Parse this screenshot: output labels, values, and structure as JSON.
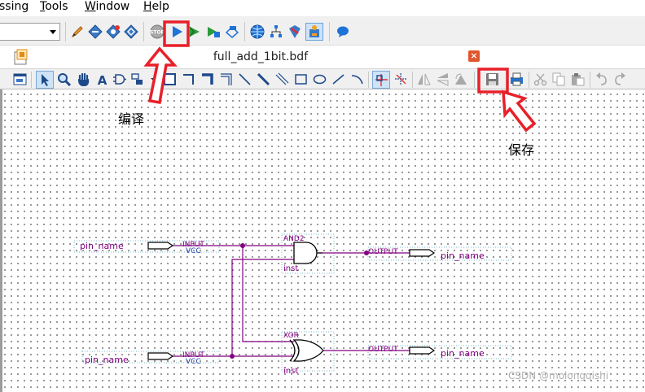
{
  "menu": {
    "items": [
      {
        "label": "ssing"
      },
      {
        "label": "Tools"
      },
      {
        "label": "Window"
      },
      {
        "label": "Help"
      }
    ]
  },
  "document": {
    "title": "full_add_1bit.bdf",
    "close_label": "×"
  },
  "annotations": {
    "compile": "编译",
    "save": "保存"
  },
  "schematic": {
    "input_pins": [
      {
        "name": "pin_name",
        "type": "INPUT",
        "default": "VCC"
      },
      {
        "name": "pin_name",
        "type": "INPUT",
        "default": "VCC"
      }
    ],
    "output_pins": [
      {
        "name": "pin_name",
        "type": "OUTPUT"
      },
      {
        "name": "pin_name",
        "type": "OUTPUT"
      }
    ],
    "gates": [
      {
        "type": "AND2",
        "instance": "inst"
      },
      {
        "type": "XOR",
        "instance": "inst"
      }
    ],
    "wire_color": "#800080"
  },
  "watermark": "CSDN @molongqishi",
  "colors": {
    "highlight": "#e8202a",
    "close": "#e0562e"
  },
  "icons": [
    "pencil-icon",
    "diamond-icon",
    "analysis-icon",
    "chip-icon",
    "stop-icon",
    "start-compile-icon",
    "flag-icon",
    "fitter-icon",
    "timing-icon",
    "globe-icon",
    "netlist-icon",
    "programmer-icon",
    "chip-planner-icon",
    "chat-icon"
  ]
}
